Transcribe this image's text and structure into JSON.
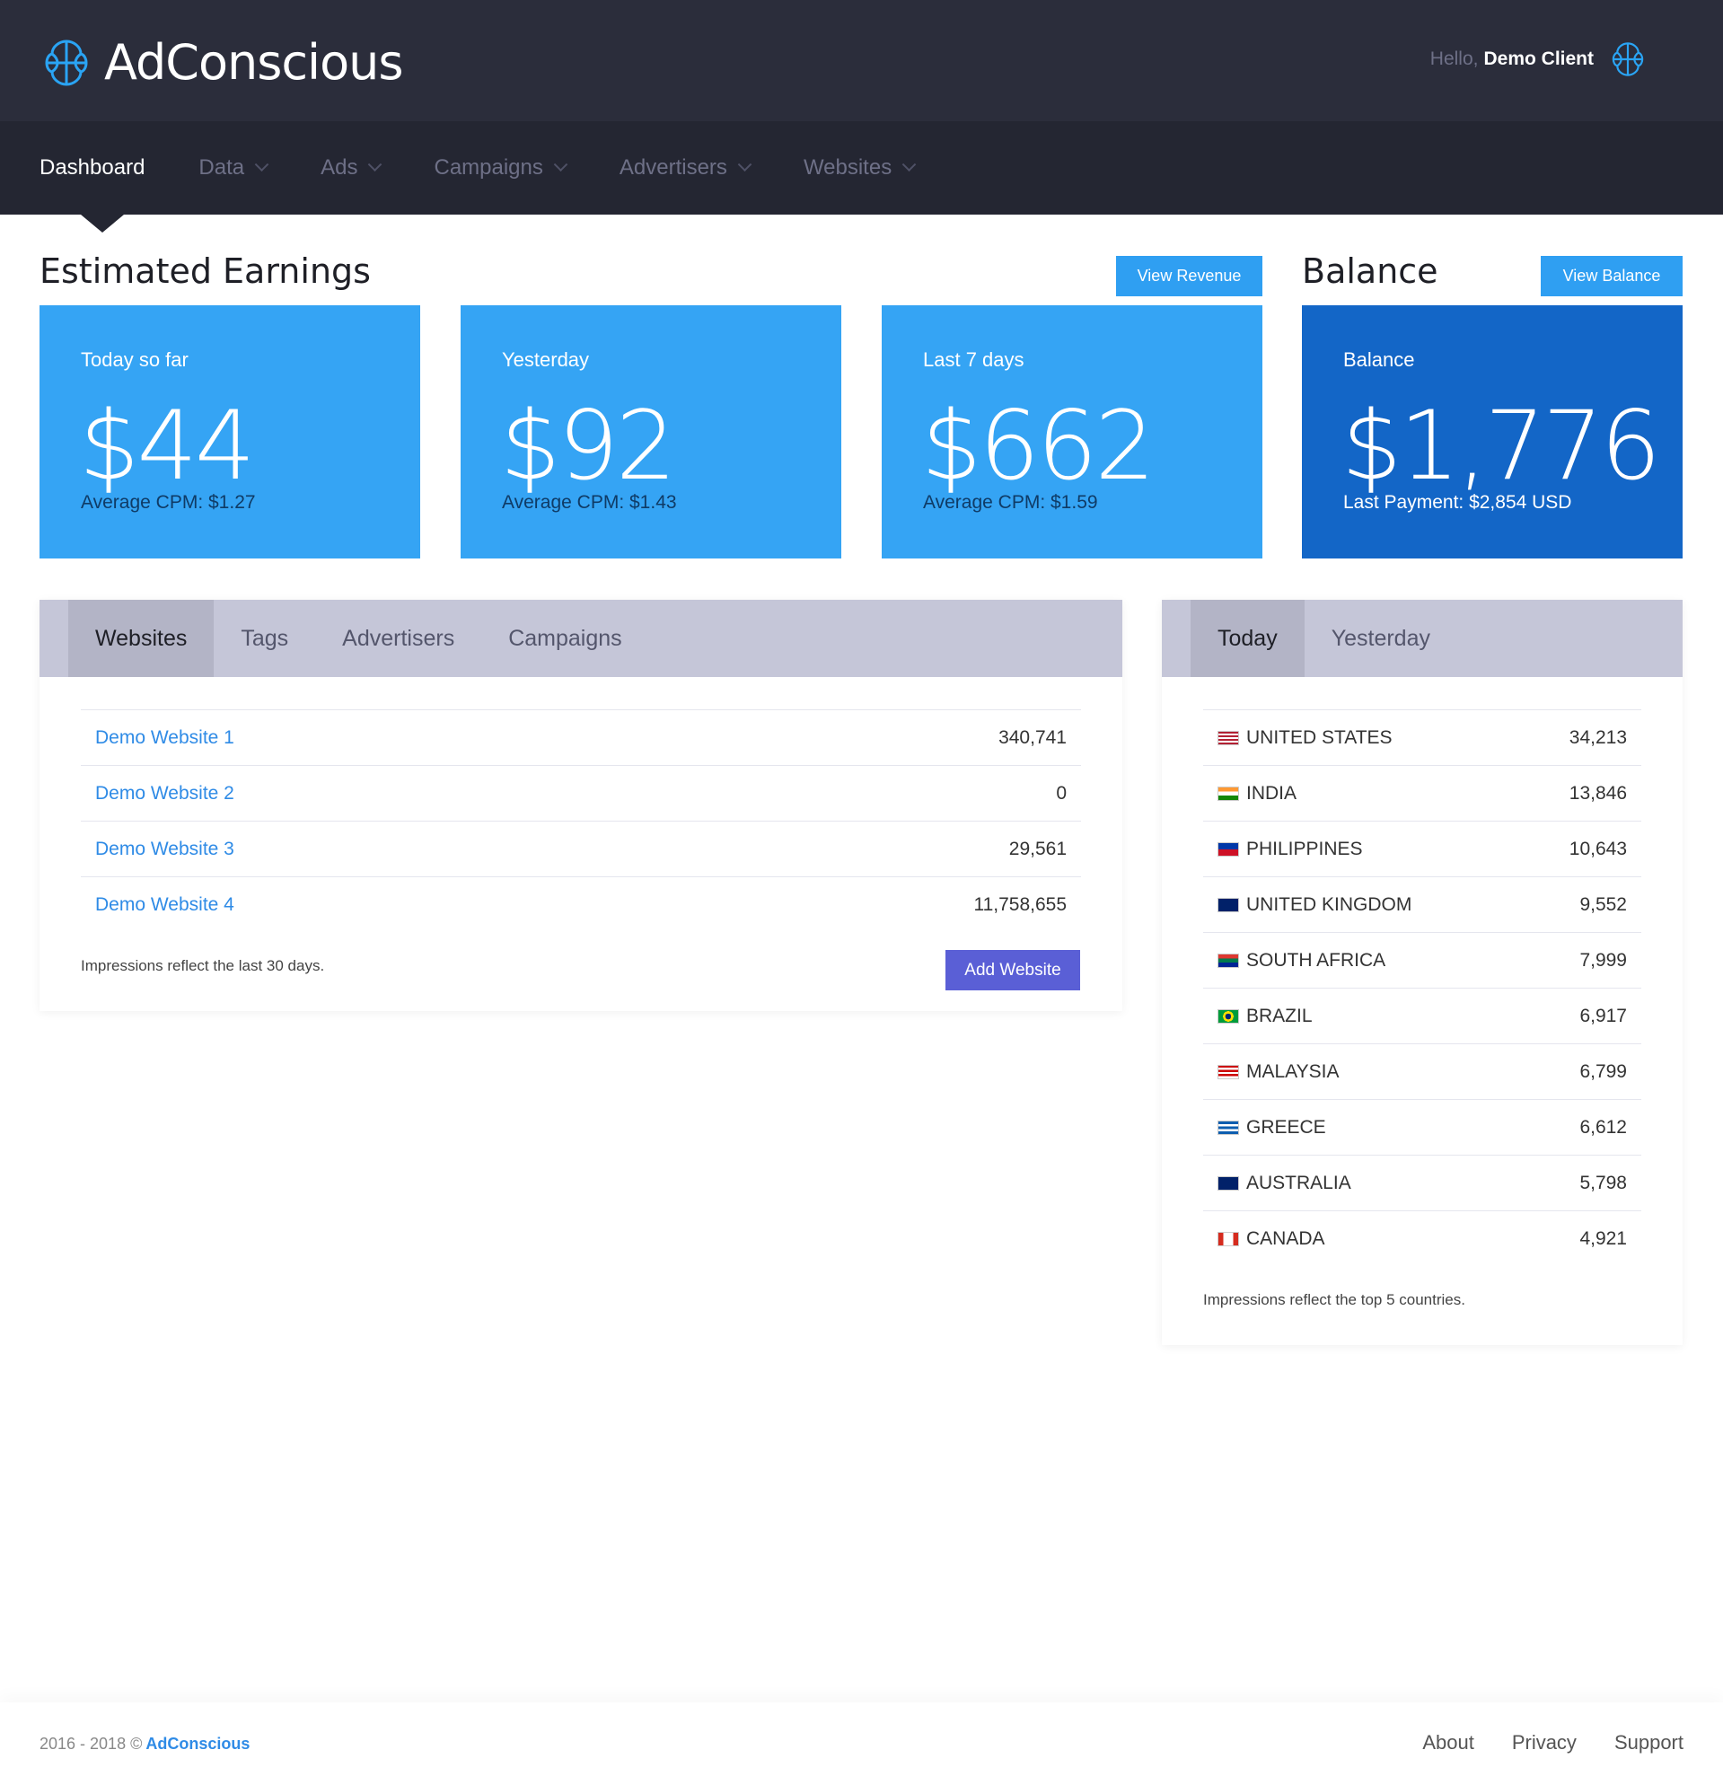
{
  "brand": {
    "name": "AdConscious",
    "icon": "brain-logo-icon",
    "color": "#2aa4f4"
  },
  "header": {
    "greeting": "Hello,",
    "user": "Demo Client"
  },
  "nav": {
    "items": [
      {
        "label": "Dashboard",
        "active": true
      },
      {
        "label": "Data"
      },
      {
        "label": "Ads"
      },
      {
        "label": "Campaigns"
      },
      {
        "label": "Advertisers"
      },
      {
        "label": "Websites"
      }
    ]
  },
  "earnings": {
    "title": "Estimated Earnings",
    "button": "View Revenue",
    "cards": [
      {
        "label": "Today so far",
        "amount": "$44",
        "sub": "Average CPM: $1.27"
      },
      {
        "label": "Yesterday",
        "amount": "$92",
        "sub": "Average CPM: $1.43"
      },
      {
        "label": "Last 7 days",
        "amount": "$662",
        "sub": "Average CPM: $1.59"
      }
    ]
  },
  "balance": {
    "title": "Balance",
    "button": "View Balance",
    "card": {
      "label": "Balance",
      "amount": "$1,776",
      "sub": "Last Payment: $2,854 USD"
    }
  },
  "left_panel": {
    "tabs": [
      "Websites",
      "Tags",
      "Advertisers",
      "Campaigns"
    ],
    "rows": [
      {
        "name": "Demo Website 1",
        "value": "340,741"
      },
      {
        "name": "Demo Website 2",
        "value": "0"
      },
      {
        "name": "Demo Website 3",
        "value": "29,561"
      },
      {
        "name": "Demo Website 4",
        "value": "11,758,655"
      }
    ],
    "note": "Impressions reflect the last 30 days.",
    "button": "Add Website"
  },
  "right_panel": {
    "tabs": [
      "Today",
      "Yesterday"
    ],
    "rows": [
      {
        "country": "UNITED STATES",
        "value": "34,213",
        "flag": "us-flag-icon"
      },
      {
        "country": "INDIA",
        "value": "13,846",
        "flag": "in-flag-icon"
      },
      {
        "country": "PHILIPPINES",
        "value": "10,643",
        "flag": "ph-flag-icon"
      },
      {
        "country": "UNITED KINGDOM",
        "value": "9,552",
        "flag": "gb-flag-icon"
      },
      {
        "country": "SOUTH AFRICA",
        "value": "7,999",
        "flag": "za-flag-icon"
      },
      {
        "country": "BRAZIL",
        "value": "6,917",
        "flag": "br-flag-icon"
      },
      {
        "country": "MALAYSIA",
        "value": "6,799",
        "flag": "my-flag-icon"
      },
      {
        "country": "GREECE",
        "value": "6,612",
        "flag": "gr-flag-icon"
      },
      {
        "country": "AUSTRALIA",
        "value": "5,798",
        "flag": "au-flag-icon"
      },
      {
        "country": "CANADA",
        "value": "4,921",
        "flag": "ca-flag-icon"
      }
    ],
    "note": "Impressions reflect the top 5 countries."
  },
  "footer": {
    "copyright": "2016 - 2018 ©",
    "brand": "AdConscious",
    "links": [
      "About",
      "Privacy",
      "Support"
    ]
  },
  "colors": {
    "header_bg": "#2b2d3b",
    "nav_bg": "#242632",
    "card_blue": "#35a4f4",
    "card_dark": "#1366c7",
    "button_blue": "#2f9ff2",
    "button_purple": "#5a5fd6",
    "link": "#2f8be6"
  }
}
